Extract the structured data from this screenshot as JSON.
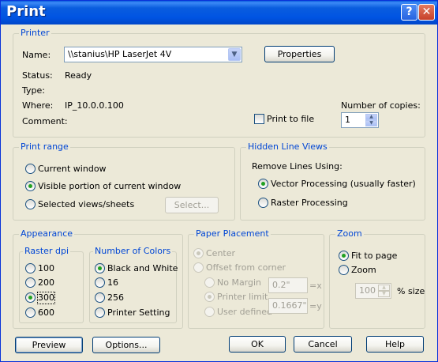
{
  "window": {
    "title": "Print",
    "help_glyph": "?",
    "close_glyph": "✕"
  },
  "printer": {
    "group_title": "Printer",
    "name_label": "Name:",
    "name_value": "\\\\stanius\\HP LaserJet 4V",
    "properties_label": "Properties",
    "status_label": "Status:",
    "status_value": "Ready",
    "type_label": "Type:",
    "type_value": "",
    "where_label": "Where:",
    "where_value": "IP_10.0.0.100",
    "comment_label": "Comment:",
    "comment_value": "",
    "print_to_file_label": "Print to file",
    "copies_label": "Number of copies:",
    "copies_value": "1"
  },
  "print_range": {
    "group_title": "Print range",
    "options": [
      "Current window",
      "Visible portion of current window",
      "Selected views/sheets"
    ],
    "selected": 1,
    "select_button": "Select..."
  },
  "hidden_lines": {
    "group_title": "Hidden Line Views",
    "remove_label": "Remove Lines Using:",
    "options": [
      "Vector Processing (usually faster)",
      "Raster Processing"
    ],
    "selected": 0
  },
  "appearance": {
    "group_title": "Appearance",
    "raster_title": "Raster dpi",
    "raster_options": [
      "100",
      "200",
      "300",
      "600"
    ],
    "raster_selected": 2,
    "colors_title": "Number of Colors",
    "color_options": [
      "Black and White",
      "16",
      "256",
      "Printer Setting"
    ],
    "color_selected": 0
  },
  "paper": {
    "group_title": "Paper Placement",
    "center_label": "Center",
    "offset_label": "Offset from corner",
    "no_margin_label": "No Margin",
    "printer_limit_label": "Printer limit",
    "user_defined_label": "User defined",
    "x_value": "0.2\"",
    "y_value": "0.1667\"",
    "x_suffix": "=x",
    "y_suffix": "=y"
  },
  "zoom": {
    "group_title": "Zoom",
    "fit_label": "Fit to page",
    "zoom_label": "Zoom",
    "zoom_value": "100",
    "size_suffix": "% size"
  },
  "buttons": {
    "preview": "Preview",
    "options": "Options...",
    "ok": "OK",
    "cancel": "Cancel",
    "help": "Help"
  }
}
